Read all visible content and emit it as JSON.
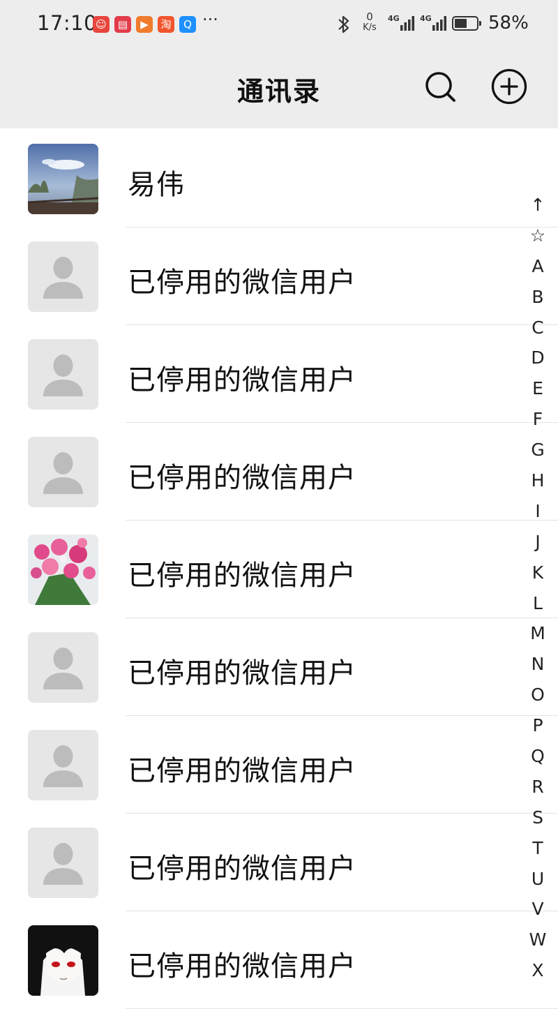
{
  "status_bar": {
    "time": "17:10",
    "app_icons": [
      {
        "name": "weibo-app-icon",
        "color": "#e8453c",
        "glyph": "☺"
      },
      {
        "name": "book-app-icon",
        "color": "#e23b4a",
        "glyph": "▤"
      },
      {
        "name": "video-app-icon",
        "color": "#f07b2c",
        "glyph": "▶"
      },
      {
        "name": "taobao-app-icon",
        "color": "#f2542d",
        "glyph": "淘"
      },
      {
        "name": "search-app-icon",
        "color": "#1e90ff",
        "glyph": "Q"
      }
    ],
    "more_indicator": "···",
    "net_speed_value": "0",
    "net_speed_unit": "K/s",
    "signal_1_label": "4G",
    "signal_2_label": "4G",
    "battery_level": 0.58,
    "battery_percent": "58%"
  },
  "header": {
    "title": "通讯录",
    "search_icon": "search-icon",
    "add_icon": "add-circle-icon"
  },
  "contacts": [
    {
      "name": "易伟",
      "avatar": "landscape-photo"
    },
    {
      "name": "已停用的微信用户",
      "avatar": "default-person"
    },
    {
      "name": "已停用的微信用户",
      "avatar": "default-person"
    },
    {
      "name": "已停用的微信用户",
      "avatar": "default-person"
    },
    {
      "name": "已停用的微信用户",
      "avatar": "flowers-photo"
    },
    {
      "name": "已停用的微信用户",
      "avatar": "default-person"
    },
    {
      "name": "已停用的微信用户",
      "avatar": "default-person"
    },
    {
      "name": "已停用的微信用户",
      "avatar": "default-person"
    },
    {
      "name": "已停用的微信用户",
      "avatar": "anime-character"
    }
  ],
  "index_bar": [
    "↑",
    "☆",
    "A",
    "B",
    "C",
    "D",
    "E",
    "F",
    "G",
    "H",
    "I",
    "J",
    "K",
    "L",
    "M",
    "N",
    "O",
    "P",
    "Q",
    "R",
    "S",
    "T",
    "U",
    "V",
    "W",
    "X"
  ]
}
